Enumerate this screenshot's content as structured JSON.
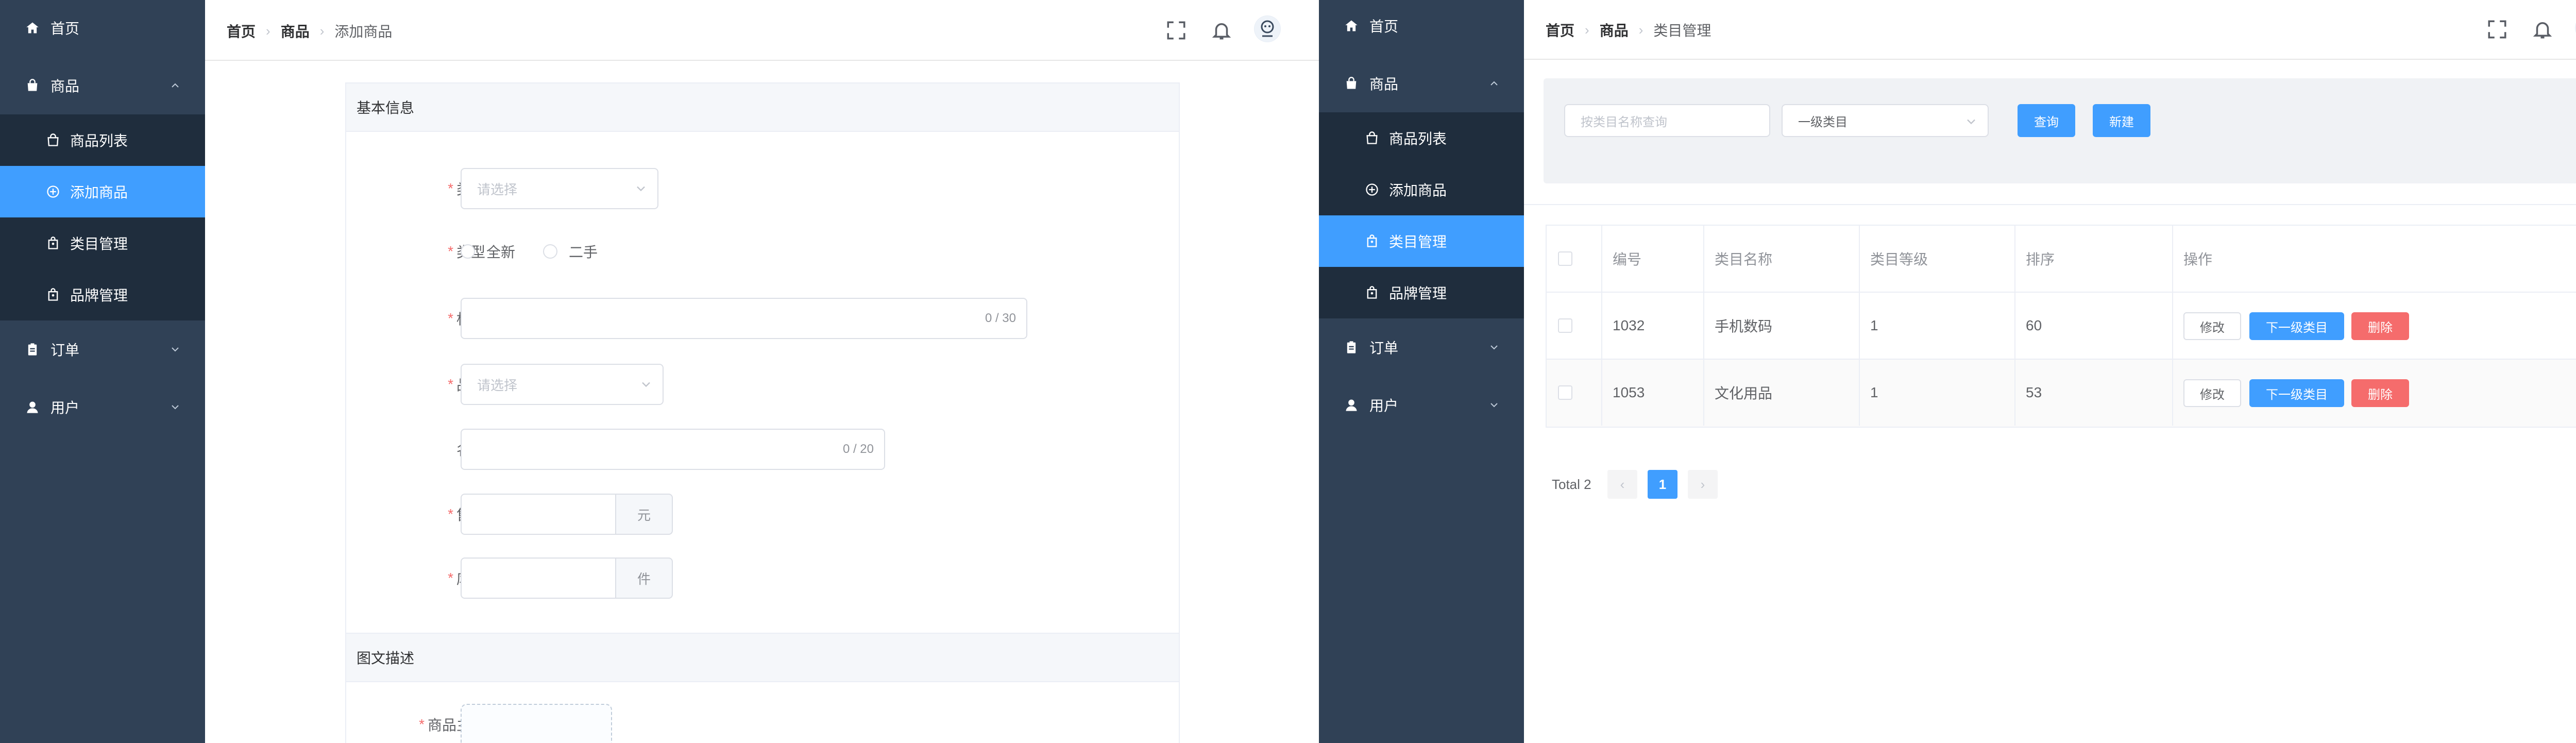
{
  "left": {
    "sidebar": {
      "home": "首页",
      "goods": "商品",
      "goods_items": [
        "商品列表",
        "添加商品",
        "类目管理",
        "品牌管理"
      ],
      "orders": "订单",
      "users": "用户"
    },
    "breadcrumb": [
      "首页",
      "商品",
      "添加商品"
    ],
    "basic_section": "基本信息",
    "fields": {
      "category": {
        "label": "类目",
        "placeholder": "请选择"
      },
      "type": {
        "label": "类型",
        "options": [
          "全新",
          "二手"
        ]
      },
      "title": {
        "label": "标题",
        "counter": "0 / 30"
      },
      "brand": {
        "label": "品牌",
        "placeholder": "请选择"
      },
      "name": {
        "label": "名称",
        "counter": "0 / 20"
      },
      "price": {
        "label": "售价",
        "unit": "元"
      },
      "stock": {
        "label": "库存",
        "unit": "件"
      }
    },
    "desc_section": "图文描述",
    "main_image_label": "商品主图"
  },
  "right": {
    "sidebar": {
      "home": "首页",
      "goods": "商品",
      "goods_items": [
        "商品列表",
        "添加商品",
        "类目管理",
        "品牌管理"
      ],
      "orders": "订单",
      "users": "用户"
    },
    "breadcrumb": [
      "首页",
      "商品",
      "类目管理"
    ],
    "filter": {
      "search_placeholder": "按类目名称查询",
      "level_select": "一级类目",
      "query": "查询",
      "create": "新建"
    },
    "table": {
      "headers": [
        "编号",
        "类目名称",
        "类目等级",
        "排序",
        "操作"
      ],
      "rows": [
        {
          "id": "1032",
          "name": "手机数码",
          "level": "1",
          "sort": "60"
        },
        {
          "id": "1053",
          "name": "文化用品",
          "level": "1",
          "sort": "53"
        }
      ],
      "actions": {
        "edit": "修改",
        "sub": "下一级类目",
        "delete": "删除"
      }
    },
    "pagination": {
      "total": "Total 2",
      "current": "1",
      "prev": "‹",
      "next": "›"
    }
  },
  "colors": {
    "sidebar": "#304156",
    "submenu": "#1f2d3d",
    "primary": "#409eff",
    "danger": "#f56c6c",
    "required": "#f56c6c"
  }
}
